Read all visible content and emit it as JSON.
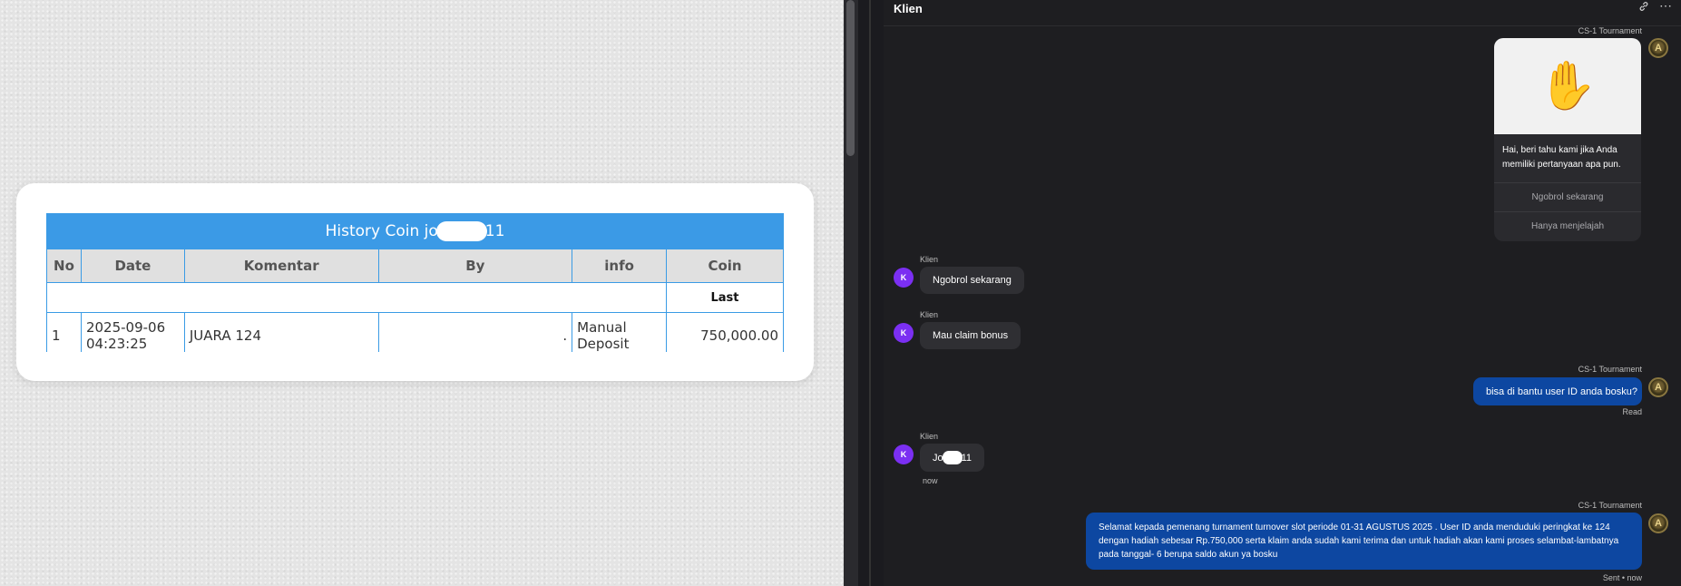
{
  "history": {
    "title_prefix": "History Coin jo",
    "title_suffix": "11",
    "columns": [
      "No",
      "Date",
      "Komentar",
      "By",
      "info",
      "Coin"
    ],
    "last_label": "Last",
    "rows": [
      {
        "no": "1",
        "date_line1": "2025-09-06",
        "date_line2": "04:23:25",
        "komentar": "JUARA 124",
        "by": ".",
        "info_line1": "Manual",
        "info_line2": "Deposit",
        "coin": "750,000.00"
      }
    ]
  },
  "chat": {
    "title": "Klien",
    "link_icon": "link-icon",
    "more_icon": "more-icon",
    "agent_name": "CS-1 Tournament",
    "client_name": "Klien",
    "client_initial": "K",
    "welcome": {
      "emoji": "✋",
      "text": "Hai, beri tahu kami jika Anda memiliki pertanyaan apa pun.",
      "option1": "Ngobrol sekarang",
      "option2": "Hanya menjelajah"
    },
    "messages": {
      "m1": "Ngobrol sekarang",
      "m2": "Mau claim bonus",
      "m3": "bisa di bantu user ID anda bosku?",
      "m3_status": "Read",
      "m4_prefix": "Jo",
      "m4_suffix": "11",
      "m4_time": "now",
      "m5": "Selamat kepada pemenang turnament turnover slot periode 01-31 AGUSTUS 2025 . User ID anda menduduki peringkat ke 124 dengan hadiah sebesar Rp.750,000 serta klaim anda sudah kami terima dan untuk hadiah akan kami proses selambat-lambatnya pada tanggal- 6 berupa saldo akun ya bosku",
      "m5_status": "Sent • now"
    }
  }
}
